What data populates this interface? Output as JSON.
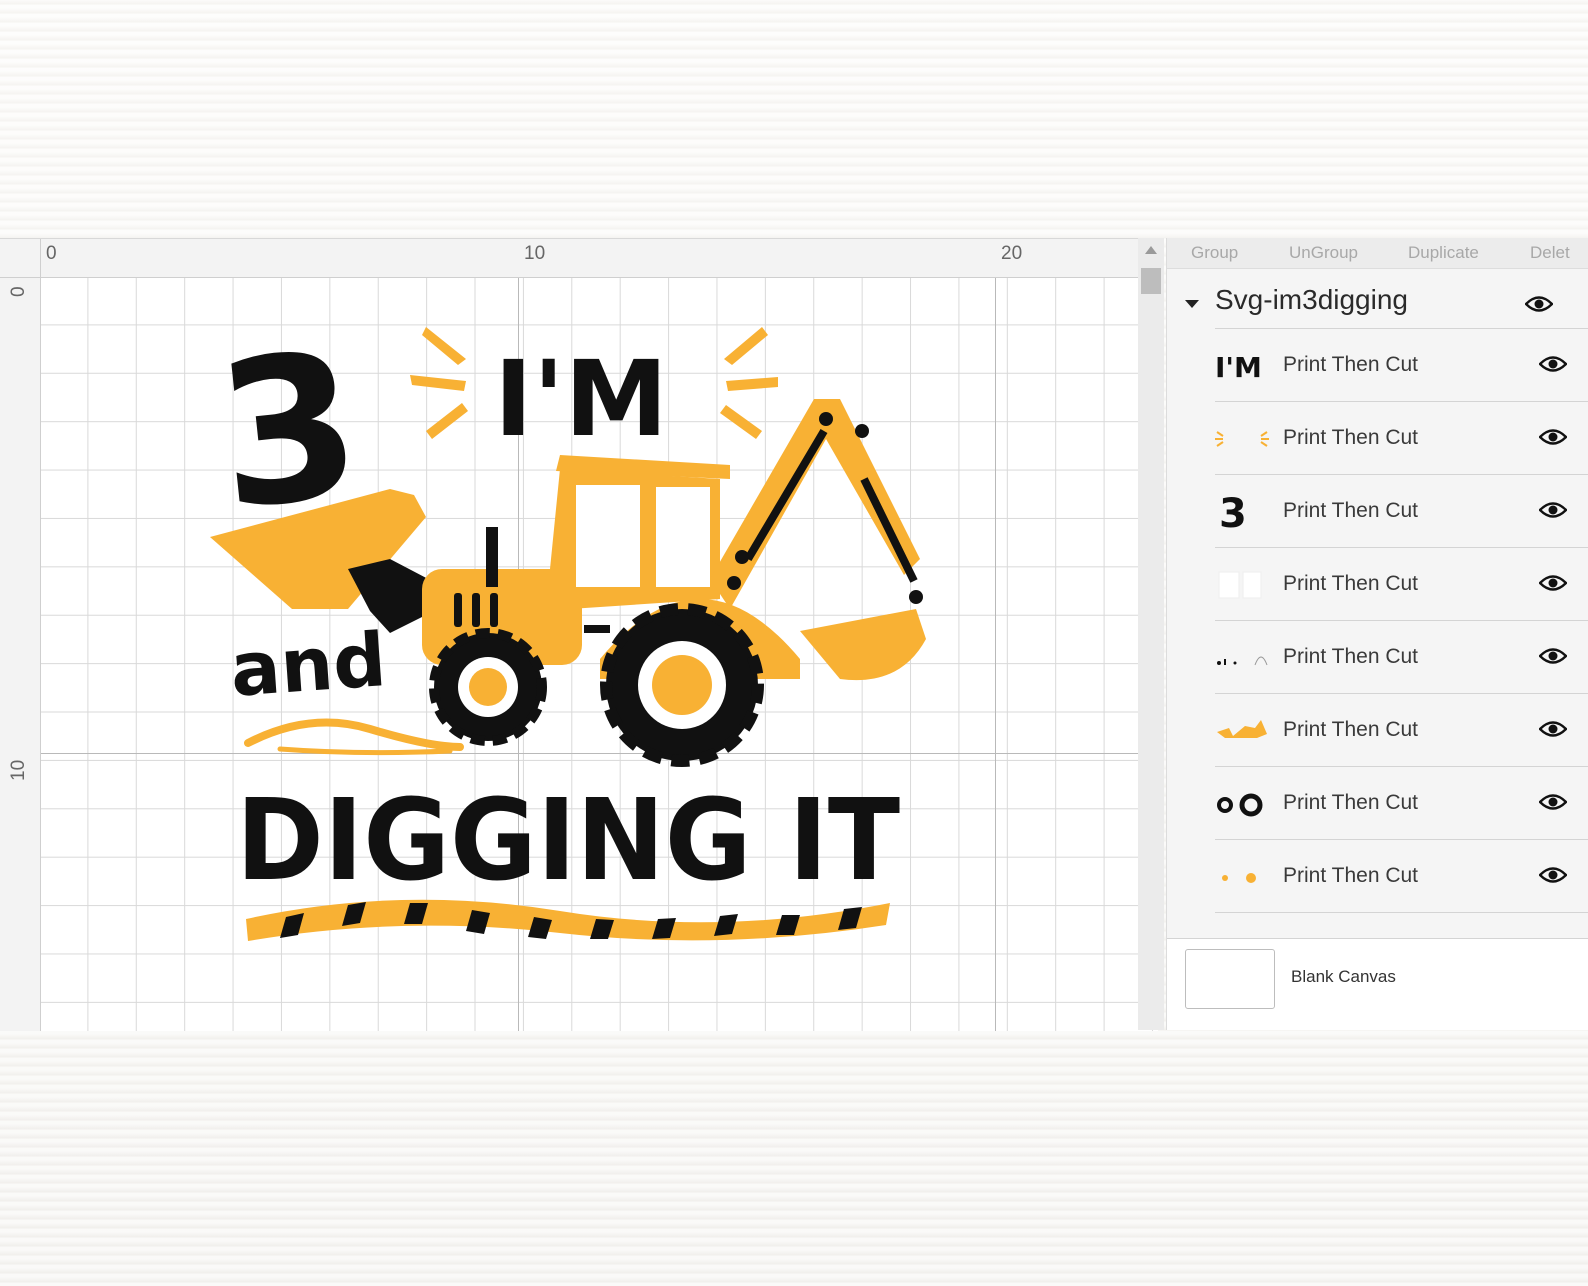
{
  "canvas": {
    "ruler_top": [
      "0",
      "10",
      "20"
    ],
    "ruler_left": [
      "0",
      "10"
    ]
  },
  "design_text": {
    "number": "3",
    "im": "I'M",
    "and": "and",
    "digging": "DIGGING IT"
  },
  "colors": {
    "accent_yellow": "#f8b134",
    "black": "#111111",
    "grid": "#d9d9d9"
  },
  "toolbar": {
    "group": "Group",
    "ungroup": "UnGroup",
    "duplicate": "Duplicate",
    "delete": "Delet"
  },
  "layers": {
    "group_name": "Svg-im3digging",
    "group_icon": "eye-icon",
    "items": [
      {
        "label": "Print Then Cut",
        "thumb": "im-text-thumb",
        "icon": "eye-icon"
      },
      {
        "label": "Print Then Cut",
        "thumb": "sparkle-lines-thumb",
        "icon": "eye-icon"
      },
      {
        "label": "Print Then Cut",
        "thumb": "number-three-thumb",
        "icon": "eye-icon"
      },
      {
        "label": "Print Then Cut",
        "thumb": "window-white-thumb",
        "icon": "eye-icon"
      },
      {
        "label": "Print Then Cut",
        "thumb": "detail-pieces-thumb",
        "icon": "eye-icon"
      },
      {
        "label": "Print Then Cut",
        "thumb": "excavator-body-thumb",
        "icon": "eye-icon"
      },
      {
        "label": "Print Then Cut",
        "thumb": "tires-thumb",
        "icon": "eye-icon"
      },
      {
        "label": "Print Then Cut",
        "thumb": "hubcaps-thumb",
        "icon": "eye-icon"
      }
    ]
  },
  "footer": {
    "blank_canvas": "Blank Canvas"
  }
}
